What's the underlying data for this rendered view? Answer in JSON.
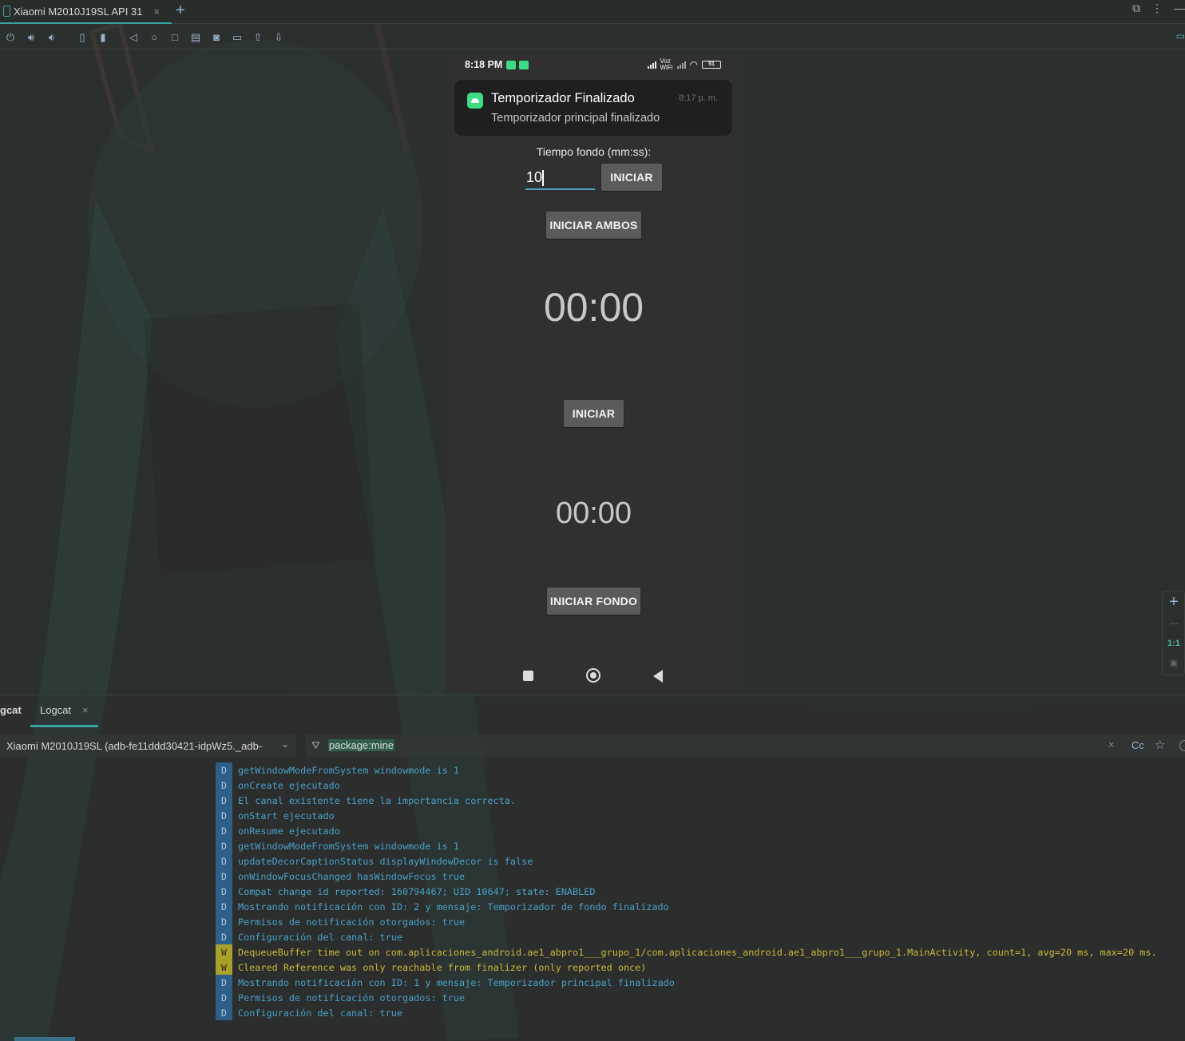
{
  "window": {
    "device_tab": "Xiaomi M2010J19SL API 31",
    "add_tab": "+",
    "close": "×"
  },
  "toolbar": {
    "icons": [
      "power-icon",
      "volume-up-icon",
      "volume-down-icon",
      "rotate-left-icon",
      "rotate-right-icon",
      "back-icon",
      "home-icon",
      "overview-icon",
      "fold-icon",
      "screenshot-icon",
      "screen-record-icon",
      "upload-icon",
      "download-icon"
    ]
  },
  "device": {
    "status": {
      "time": "8:18 PM",
      "network_label": "Voz WiFi",
      "battery": "51"
    },
    "notification": {
      "title": "Temporizador Finalizado",
      "time": "8:17 p. m.",
      "text": "Temporizador principal finalizado"
    },
    "fondo_label": "Tiempo fondo (mm:ss):",
    "fondo_input": "10",
    "btn_iniciar_top": "INICIAR",
    "btn_iniciar_ambos": "INICIAR AMBOS",
    "timer_main": "00:00",
    "btn_iniciar": "INICIAR",
    "timer_fondo": "00:00",
    "btn_iniciar_fondo": "INICIAR FONDO"
  },
  "zoom": {
    "plus": "+",
    "one_to_one": "1:1"
  },
  "logcat": {
    "tab_left": "gcat",
    "tab_active": "Logcat",
    "device_select": "Xiaomi M2010J19SL (adb-fe11ddd30421-idpWz5._adb-",
    "filter": "package:mine",
    "cc": "Cc",
    "rows": [
      {
        "level": "D",
        "msg": "getWindowModeFromSystem  windowmode is 1"
      },
      {
        "level": "D",
        "msg": "onCreate ejecutado"
      },
      {
        "level": "D",
        "msg": "El canal existente tiene la importancia correcta."
      },
      {
        "level": "D",
        "msg": "onStart ejecutado"
      },
      {
        "level": "D",
        "msg": "onResume ejecutado"
      },
      {
        "level": "D",
        "msg": "getWindowModeFromSystem  windowmode is 1"
      },
      {
        "level": "D",
        "msg": "updateDecorCaptionStatus displayWindowDecor is false"
      },
      {
        "level": "D",
        "msg": "onWindowFocusChanged hasWindowFocus true"
      },
      {
        "level": "D",
        "msg": "Compat change id reported: 160794467; UID 10647; state: ENABLED"
      },
      {
        "level": "D",
        "msg": "Mostrando notificación con ID: 2 y mensaje: Temporizador de fondo finalizado"
      },
      {
        "level": "D",
        "msg": "Permisos de notificación otorgados: true"
      },
      {
        "level": "D",
        "msg": "Configuración del canal: true"
      },
      {
        "level": "W",
        "msg": "DequeueBuffer time out on com.aplicaciones_android.ae1_abpro1___grupo_1/com.aplicaciones_android.ae1_abpro1___grupo_1.MainActivity, count=1, avg=20 ms, max=20 ms."
      },
      {
        "level": "W",
        "msg": "Cleared Reference was only reachable from finalizer (only reported once)"
      },
      {
        "level": "D",
        "msg": "Mostrando notificación con ID: 1 y mensaje: Temporizador principal finalizado"
      },
      {
        "level": "D",
        "msg": "Permisos de notificación otorgados: true"
      },
      {
        "level": "D",
        "msg": "Configuración del canal: true"
      }
    ]
  }
}
